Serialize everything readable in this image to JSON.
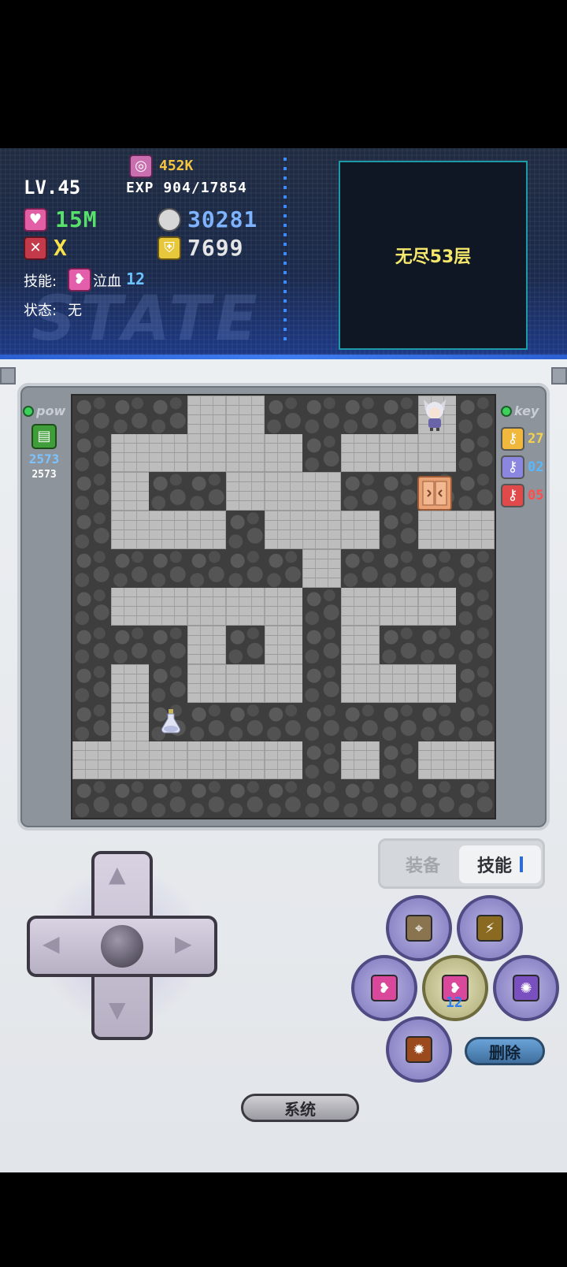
{
  "stats": {
    "level": "LV.45",
    "gold": "452K",
    "exp": "EXP 904/17854",
    "hp": "15M",
    "attack": "30281",
    "weapon": "X",
    "defense": "7699",
    "skill_label": "技能:",
    "skill_name": "泣血",
    "skill_count": "12",
    "status_label": "状态:",
    "status_value": "无",
    "watermark": "STATE"
  },
  "floor": {
    "title": "无尽53层"
  },
  "left_panel": {
    "title": "pow",
    "value_main": "2573",
    "value_sub": "2573"
  },
  "right_panel": {
    "title": "key",
    "keys": [
      {
        "color": "#f0b83c",
        "count": "27",
        "count_color": "#f6d24a"
      },
      {
        "color": "#8b86e0",
        "count": "02",
        "count_color": "#58b8ff"
      },
      {
        "color": "#e04a4a",
        "count": "05",
        "count_color": "#ff4d4d"
      }
    ]
  },
  "maze": {
    "rows": [
      "WWWFFWWWWFW",
      "WFFFFFWFFFW",
      "WFWWFFFWWWW",
      "WFFFWFFFWFF",
      "WWWWWWFWWWW",
      "WFFFFFWFFFW",
      "WWWFWFWFWWW",
      "WFWFFFWFFFW",
      "WFWWWWWWWWW",
      "FFFFFFWFWFF",
      "WWWWWWWWWWW"
    ]
  },
  "tabs": {
    "equip": "装备",
    "skill": "技能"
  },
  "buttons": {
    "delete": "删除",
    "system": "系统",
    "center_skill_count": "12"
  }
}
